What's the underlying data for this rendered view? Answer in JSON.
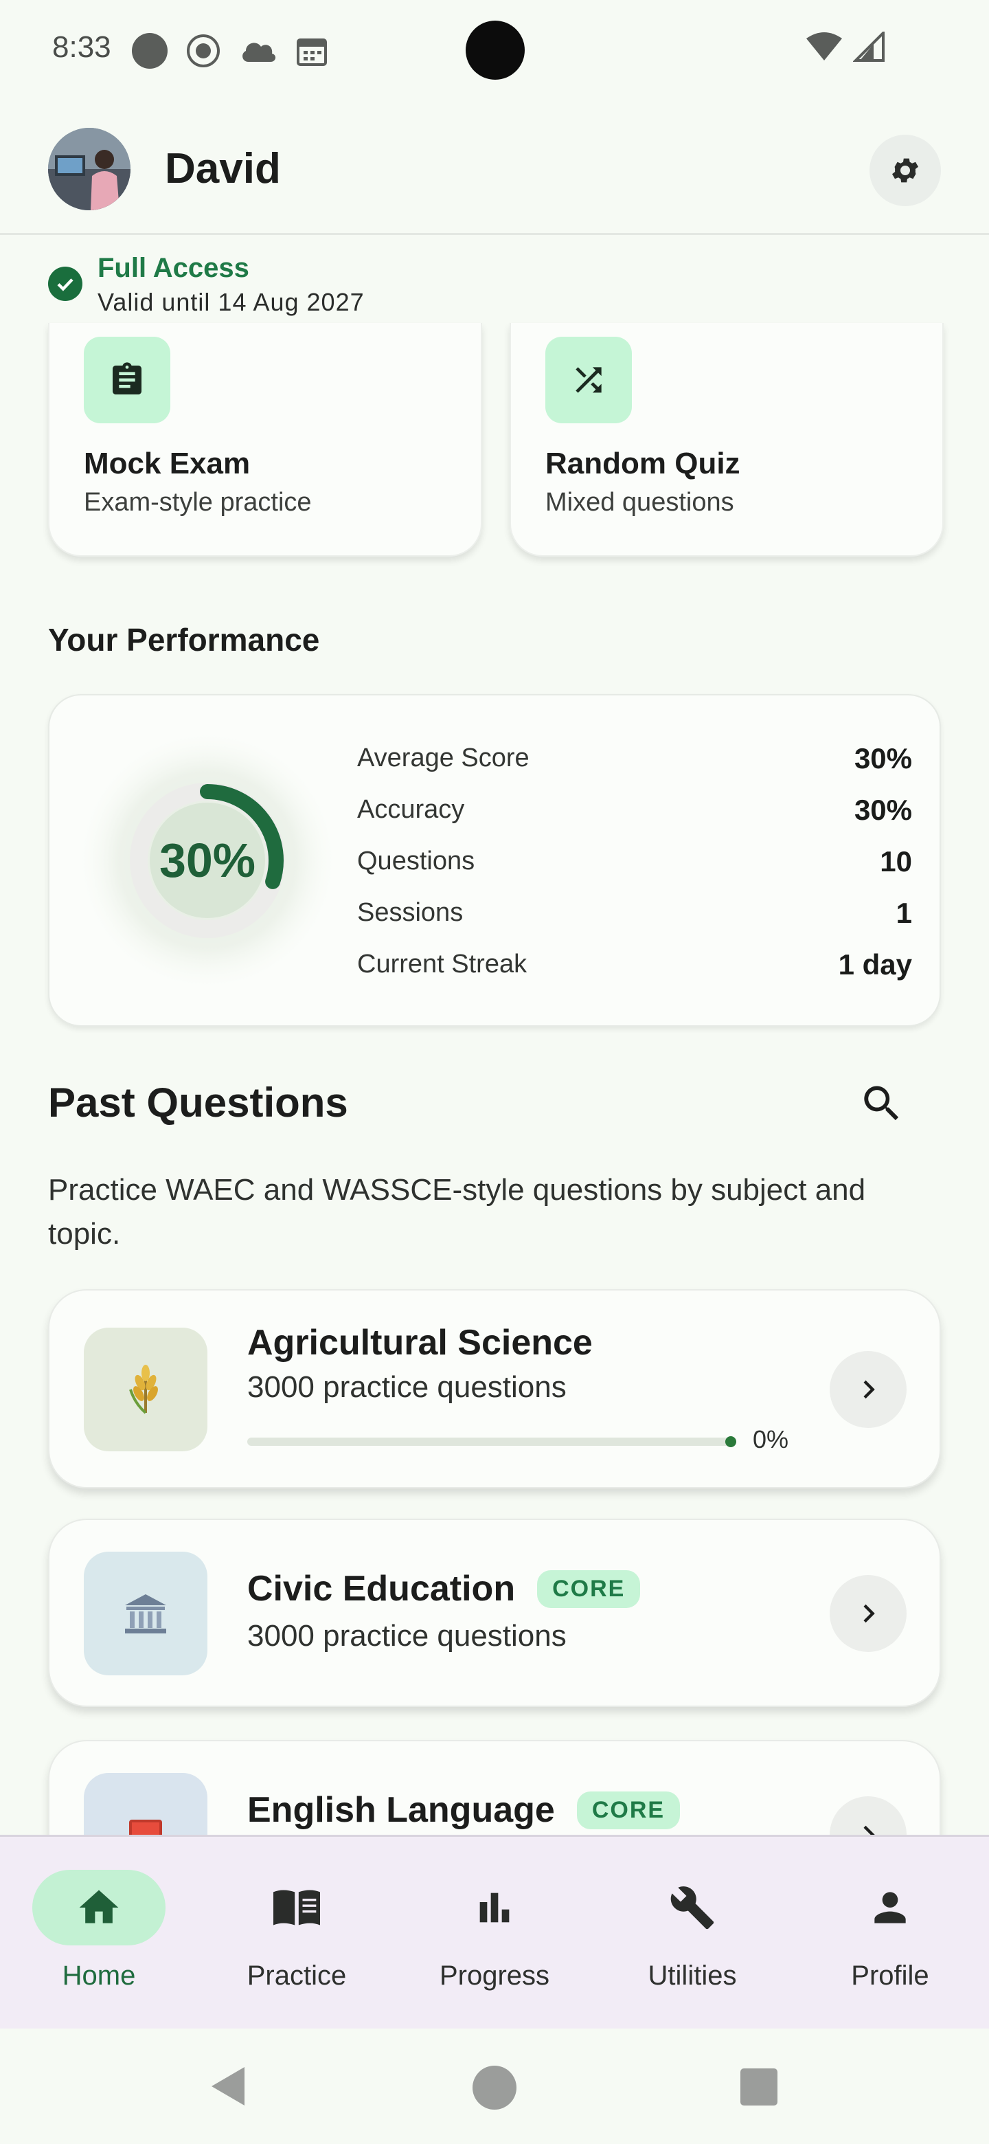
{
  "status_bar": {
    "time": "8:33"
  },
  "header": {
    "user_name": "David",
    "avatar_icon": "user-photo",
    "settings_icon": "gear-icon"
  },
  "access": {
    "title": "Full Access",
    "valid_until": "Valid until 14 Aug 2027"
  },
  "quick_actions": [
    {
      "title": "Mock Exam",
      "subtitle": "Exam-style practice",
      "icon": "clipboard-icon"
    },
    {
      "title": "Random Quiz",
      "subtitle": "Mixed questions",
      "icon": "shuffle-icon"
    }
  ],
  "performance": {
    "section_title": "Your Performance",
    "ring_percent_text": "30%",
    "ring_value": 0.3,
    "stats": [
      {
        "label": "Average Score",
        "value": "30%"
      },
      {
        "label": "Accuracy",
        "value": "30%"
      },
      {
        "label": "Questions",
        "value": "10"
      },
      {
        "label": "Sessions",
        "value": "1"
      },
      {
        "label": "Current Streak",
        "value": "1 day"
      }
    ]
  },
  "past_questions": {
    "title": "Past Questions",
    "description": "Practice WAEC and WASSCE-style questions by subject and topic.",
    "subjects": [
      {
        "name": "Agricultural Science",
        "count": "3000 practice questions",
        "progress_label": "0%",
        "progress": 0.0,
        "badge": "",
        "icon": "wheat-icon"
      },
      {
        "name": "Civic Education",
        "count": "3000 practice questions",
        "badge": "CORE",
        "icon": "government-building-icon"
      },
      {
        "name": "English Language",
        "count": "",
        "badge": "CORE",
        "icon": "book-icon"
      }
    ]
  },
  "bottom_nav": [
    {
      "label": "Home",
      "icon": "home-icon",
      "active": true
    },
    {
      "label": "Practice",
      "icon": "open-book-icon",
      "active": false
    },
    {
      "label": "Progress",
      "icon": "bar-chart-icon",
      "active": false
    },
    {
      "label": "Utilities",
      "icon": "wrench-icon",
      "active": false
    },
    {
      "label": "Profile",
      "icon": "person-icon",
      "active": false
    }
  ],
  "colors": {
    "accent": "#1f7a47",
    "accent_light": "#c3f1d3",
    "background": "#f6faf4",
    "nav_background": "#f2ecf6"
  }
}
